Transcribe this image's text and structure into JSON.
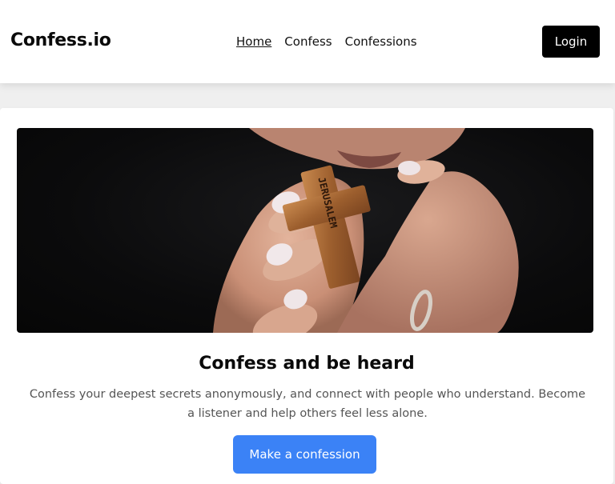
{
  "header": {
    "brand": "Confess.io",
    "nav": [
      {
        "label": "Home",
        "active": true
      },
      {
        "label": "Confess",
        "active": false
      },
      {
        "label": "Confessions",
        "active": false
      }
    ],
    "login_label": "Login"
  },
  "hero": {
    "image": "hands holding a wooden cross pendant engraved JERUSALEM against a dark background",
    "cross_engraving": "JERUSALEM"
  },
  "main": {
    "headline": "Confess and be heard",
    "subtext": "Confess your deepest secrets anonymously, and connect with people who understand. Become a listener and help others feel less alone.",
    "cta_label": "Make a confession"
  },
  "colors": {
    "page_bg": "#efefef",
    "accent": "#3b82f6",
    "login_bg": "#000000",
    "hero_bg": "#0b0b0c"
  }
}
